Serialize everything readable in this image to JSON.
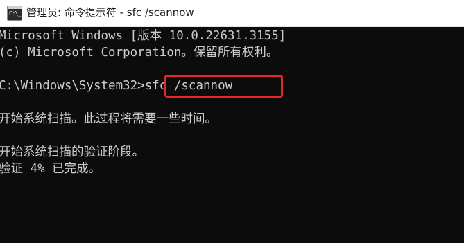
{
  "window": {
    "title": "管理员: 命令提示符 - sfc  /scannow",
    "icon": "command-prompt-icon",
    "icon_glyph": "C:\\_"
  },
  "console": {
    "lines": [
      "Microsoft Windows [版本 10.0.22631.3155]",
      "(c) Microsoft Corporation。保留所有权利。",
      "",
      "C:\\Windows\\System32>sfc /scannow",
      "",
      "开始系统扫描。此过程将需要一些时间。",
      "",
      "开始系统扫描的验证阶段。",
      "验证 4% 已完成。"
    ],
    "prompt": "C:\\Windows\\System32>",
    "command": "sfc /scannow",
    "highlight_color": "#e8262a"
  }
}
